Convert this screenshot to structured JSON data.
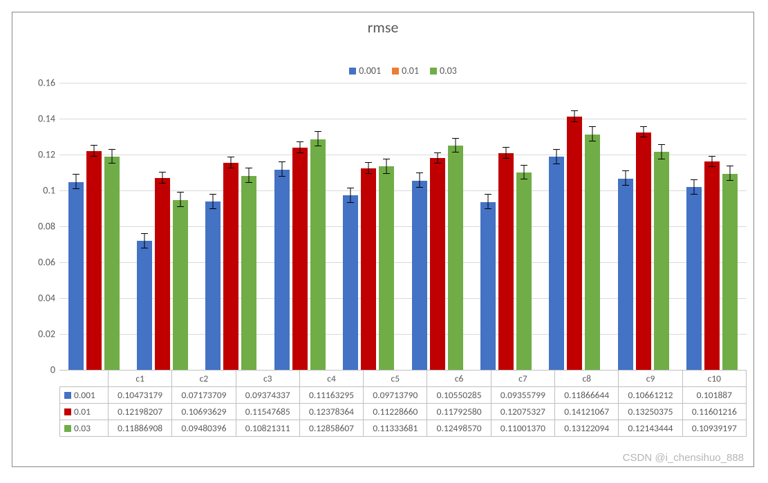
{
  "title": "rmse",
  "watermark": "CSDN @i_chensihuo_888",
  "legend": {
    "items": [
      {
        "name": "0.001",
        "color": "#4472C4"
      },
      {
        "name": "0.01",
        "color": "#ED7D31"
      },
      {
        "name": "0.03",
        "color": "#70AD47"
      }
    ]
  },
  "y_axis": {
    "min": 0,
    "max": 0.16,
    "ticks": [
      0,
      0.02,
      0.04,
      0.06,
      0.08,
      0.1,
      0.12,
      0.14,
      0.16
    ],
    "tick_labels": [
      "0",
      "0.02",
      "0.04",
      "0.06",
      "0.08",
      "0.1",
      "0.12",
      "0.14",
      "0.16"
    ]
  },
  "chart_data": {
    "type": "bar",
    "title": "rmse",
    "xlabel": "",
    "ylabel": "",
    "ylim": [
      0,
      0.16
    ],
    "categories": [
      "c1",
      "c2",
      "c3",
      "c4",
      "c5",
      "c6",
      "c7",
      "c8",
      "c9",
      "c10"
    ],
    "series": [
      {
        "name": "0.001",
        "color": "#4472C4",
        "values": [
          0.10473179,
          0.07173709,
          0.09374337,
          0.11163295,
          0.0971379,
          0.10550285,
          0.09355799,
          0.11866644,
          0.10661212,
          0.101887
        ],
        "error": [
          0.004,
          0.004,
          0.004,
          0.004,
          0.004,
          0.004,
          0.004,
          0.004,
          0.004,
          0.004
        ],
        "display_values": [
          "0.10473179",
          "0.07173709",
          "0.09374337",
          "0.11163295",
          "0.09713790",
          "0.10550285",
          "0.09355799",
          "0.11866644",
          "0.10661212",
          "0.101887"
        ]
      },
      {
        "name": "0.01",
        "color": "#C00000",
        "values": [
          0.12198207,
          0.10693629,
          0.11547685,
          0.12378364,
          0.1122866,
          0.1179258,
          0.12075327,
          0.14121067,
          0.13250375,
          0.11601216
        ],
        "error": [
          0.003,
          0.003,
          0.003,
          0.003,
          0.003,
          0.003,
          0.003,
          0.003,
          0.003,
          0.003
        ],
        "display_values": [
          "0.12198207",
          "0.10693629",
          "0.11547685",
          "0.12378364",
          "0.11228660",
          "0.11792580",
          "0.12075327",
          "0.14121067",
          "0.13250375",
          "0.11601216"
        ]
      },
      {
        "name": "0.03",
        "color": "#70AD47",
        "values": [
          0.11886908,
          0.09480396,
          0.10821311,
          0.12858607,
          0.11333681,
          0.1249857,
          0.1100137,
          0.13122094,
          0.12143444,
          0.10939197
        ],
        "error": [
          0.004,
          0.004,
          0.004,
          0.004,
          0.004,
          0.004,
          0.004,
          0.004,
          0.004,
          0.004
        ],
        "display_values": [
          "0.11886908",
          "0.09480396",
          "0.10821311",
          "0.12858607",
          "0.11333681",
          "0.12498570",
          "0.11001370",
          "0.13122094",
          "0.12143444",
          "0.10939197"
        ]
      }
    ],
    "legend_position": "top",
    "grid": true,
    "error_bars": true
  },
  "table": {
    "row_header_colors": [
      "#4472C4",
      "#C00000",
      "#70AD47"
    ]
  }
}
